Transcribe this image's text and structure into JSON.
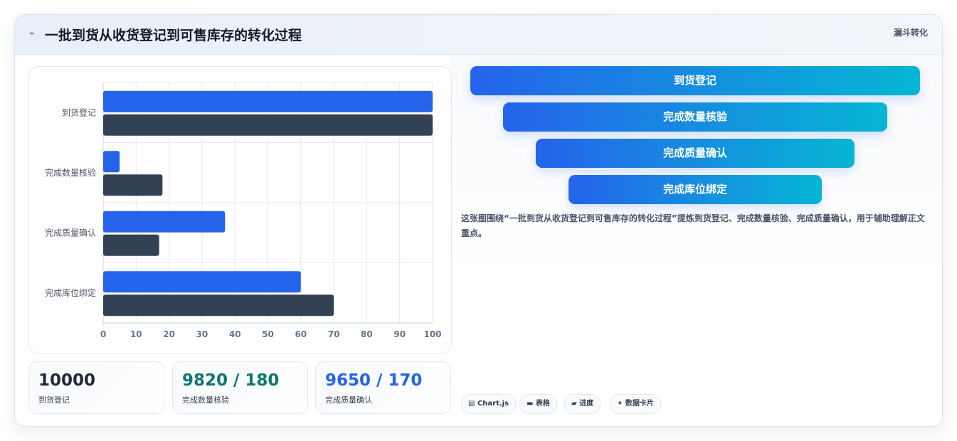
{
  "header": {
    "icon": "lightning-icon",
    "title": "一批到货从收货登记到可售库存的转化过程",
    "tag": "漏斗转化"
  },
  "chart_data": {
    "type": "bar",
    "orientation": "horizontal",
    "categories": [
      "到货登记",
      "完成数量核验",
      "完成质量确认",
      "完成库位绑定"
    ],
    "series": [
      {
        "values": [
          100,
          5,
          37,
          60
        ],
        "color": "#2563eb"
      },
      {
        "values": [
          100,
          18,
          17,
          70
        ],
        "color": "#334155"
      }
    ],
    "xlim": [
      0,
      100
    ],
    "xticks": [
      0,
      10,
      20,
      30,
      40,
      50,
      60,
      70,
      80,
      90,
      100
    ],
    "grid": true
  },
  "stats": [
    {
      "value": "10000",
      "label": "到货登记",
      "color": "#1f2937"
    },
    {
      "value": "9820 / 180",
      "label": "完成数量核验",
      "color": "#0f766e"
    },
    {
      "value": "9650 / 170",
      "label": "完成质量确认",
      "color": "#2563eb"
    }
  ],
  "funnel": [
    {
      "label": "到货登记"
    },
    {
      "label": "完成数量核验"
    },
    {
      "label": "完成质量确认"
    },
    {
      "label": "完成库位绑定"
    }
  ],
  "description": "这张图围绕“一批到货从收货登记到可售库存的转化过程”提炼到货登记、完成数量核验、完成质量确认，用于辅助理解正文重点。",
  "tags": [
    {
      "icon": "chart-icon",
      "glyph": "▤",
      "label": "Chart.js"
    },
    {
      "icon": "table-icon",
      "glyph": "▬",
      "label": "表格"
    },
    {
      "icon": "progress-icon",
      "glyph": "▰",
      "label": "进度"
    },
    {
      "icon": "sparkle-icon",
      "glyph": "✦",
      "label": "数据卡片"
    }
  ]
}
